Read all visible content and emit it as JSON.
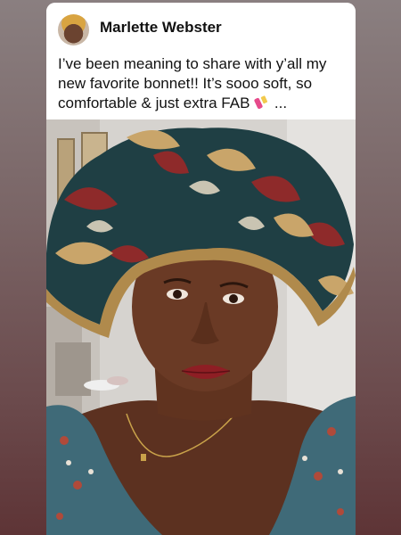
{
  "post": {
    "author_name": "Marlette Webster",
    "caption": "I’ve been meaning to share with y’all my new favorite bonnet!! It’s sooo soft, so comfortable & just extra FAB",
    "caption_suffix": "...",
    "caption_emoji": "nail-polish-emoji"
  },
  "colors": {
    "background_top": "#8a7f80",
    "background_bottom": "#5e3436",
    "card_bg": "#ffffff",
    "text": "#111111"
  }
}
